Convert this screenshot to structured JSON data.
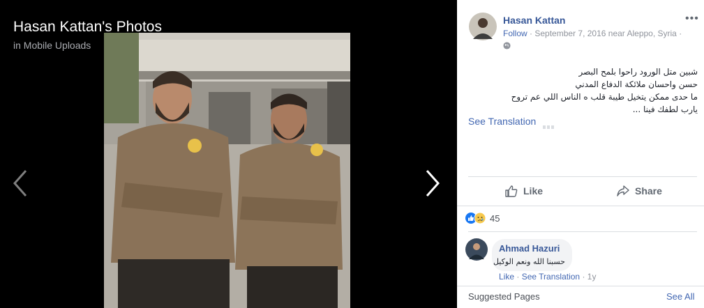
{
  "viewer": {
    "title": "Hasan Kattan's Photos",
    "subtitle": "in Mobile Uploads"
  },
  "post": {
    "author": "Hasan Kattan",
    "follow": "Follow",
    "meta": "September 7, 2016 near Aleppo, Syria",
    "text_lines": [
      "شبين متل الورود راحوا بلمح البصر",
      "حسن واحسان ملائكة الدفاع المدني",
      "ما حدى ممكن يتخيل طيبة قلب ه الناس اللي عم تروح",
      "يارب لطفك فينا ..."
    ],
    "see_translation": "See Translation",
    "more_icon": "more-dots-icon"
  },
  "actions": {
    "like": "Like",
    "share": "Share"
  },
  "reactions": {
    "count": "45",
    "types": [
      "like-reaction-icon",
      "sad-reaction-icon"
    ]
  },
  "comment": {
    "author": "Ahmad Hazuri",
    "text": "حسبنا الله ونعم الوكيل",
    "like": "Like",
    "see_translation": "See Translation",
    "age": "1y"
  },
  "suggested": {
    "title": "Suggested Pages",
    "see_all": "See All"
  },
  "colors": {
    "link": "#385898",
    "accent": "#4267b2",
    "meta": "#90949c"
  }
}
